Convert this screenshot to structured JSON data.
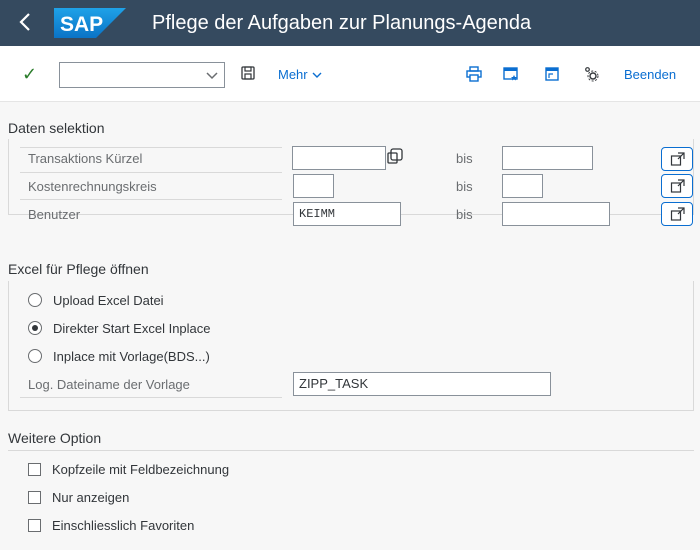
{
  "shell": {
    "title": "Pflege der Aufgaben zur Planungs-Agenda",
    "logo_text": "SAP"
  },
  "toolbar": {
    "combo_value": "",
    "mehr_label": "Mehr",
    "beenden_label": "Beenden"
  },
  "selection": {
    "title": "Daten selektion",
    "bis_label": "bis",
    "rows": [
      {
        "label": "Transaktions Kürzel",
        "from": "",
        "to": ""
      },
      {
        "label": "Kostenrechnungskreis",
        "from": "",
        "to": ""
      },
      {
        "label": "Benutzer",
        "from": "KEIMM",
        "to": ""
      }
    ]
  },
  "excel": {
    "title": "Excel für Pflege öffnen",
    "options": [
      {
        "label": "Upload Excel Datei",
        "selected": false
      },
      {
        "label": "Direkter Start Excel Inplace",
        "selected": true
      },
      {
        "label": "Inplace mit Vorlage(BDS...)",
        "selected": false
      }
    ],
    "template_label": "Log. Dateiname der Vorlage",
    "template_value": "ZIPP_TASK"
  },
  "further": {
    "title": "Weitere Option",
    "options": [
      {
        "label": "Kopfzeile mit Feldbezeichnung",
        "checked": false
      },
      {
        "label": "Nur anzeigen",
        "checked": false
      },
      {
        "label": "Einschliesslich Favoriten",
        "checked": false
      }
    ]
  },
  "colors": {
    "shell_bg": "#354a5f",
    "link": "#0a6ed1",
    "accept_green": "#2b7d2b",
    "sap_logo": "#0a8ad1"
  },
  "icons": [
    "back-icon",
    "sap-logo",
    "check-icon",
    "dropdown-arrow-icon",
    "save-icon",
    "print-icon",
    "bookmark-icon",
    "new-window-icon",
    "settings-icon",
    "value-help-icon",
    "multiple-selection-icon"
  ]
}
